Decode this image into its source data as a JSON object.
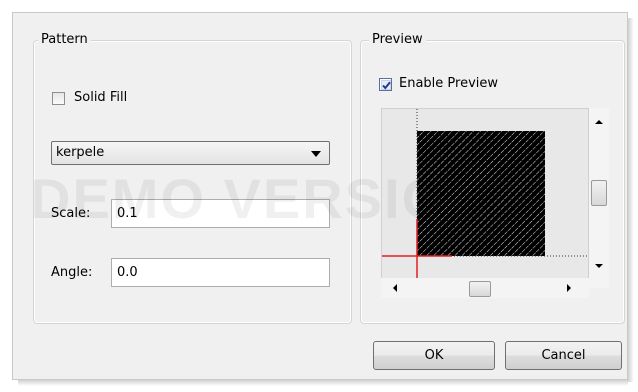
{
  "pattern_group": {
    "title": "Pattern",
    "solid_fill_label": "Solid Fill",
    "solid_fill_checked": false,
    "pattern_select": {
      "value": "kerpele"
    },
    "scale": {
      "label": "Scale:",
      "value": "0.1"
    },
    "angle": {
      "label": "Angle:",
      "value": "0.0"
    }
  },
  "preview_group": {
    "title": "Preview",
    "enable_preview_label": "Enable Preview",
    "enable_preview_checked": true
  },
  "watermark": "DEMO VERSION",
  "buttons": {
    "ok": "OK",
    "cancel": "Cancel"
  },
  "colors": {
    "dialog_bg": "#f0f0f0",
    "axis": "#e02020",
    "pattern": "#000000"
  }
}
